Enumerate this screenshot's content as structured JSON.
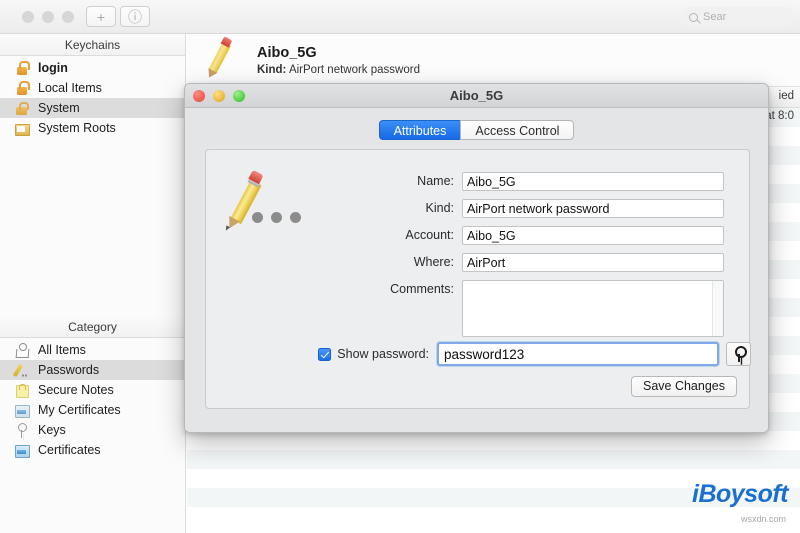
{
  "window": {
    "toolbar": {
      "add_label": "+",
      "info_label": "ⓘ",
      "search_placeholder": "Sear"
    }
  },
  "sidebar": {
    "keychains_header": "Keychains",
    "keychains": [
      {
        "label": "login",
        "icon": "lock-open-icon",
        "selected": false,
        "bold": true
      },
      {
        "label": "Local Items",
        "icon": "lock-open-icon",
        "selected": false,
        "bold": false
      },
      {
        "label": "System",
        "icon": "lock-closed-icon",
        "selected": true,
        "bold": false
      },
      {
        "label": "System Roots",
        "icon": "folder-icon",
        "selected": false,
        "bold": false
      }
    ],
    "category_header": "Category",
    "categories": [
      {
        "label": "All Items",
        "icon": "keyring-icon",
        "selected": false
      },
      {
        "label": "Passwords",
        "icon": "pencil-icon",
        "selected": true
      },
      {
        "label": "Secure Notes",
        "icon": "note-icon",
        "selected": false
      },
      {
        "label": "My Certificates",
        "icon": "certificate-icon",
        "selected": false
      },
      {
        "label": "Keys",
        "icon": "key-icon",
        "selected": false
      },
      {
        "label": "Certificates",
        "icon": "certificate-blue-icon",
        "selected": false
      }
    ]
  },
  "content": {
    "item_title": "Aibo_5G",
    "item_kind_label": "Kind:",
    "item_kind_value": "AirPort network password",
    "column_modified": "ied",
    "row_modified_value": "at 8:0",
    "watermark": "iBoysoft",
    "watermark_sub": "wsxdn.com"
  },
  "dialog": {
    "title": "Aibo_5G",
    "tabs": [
      {
        "label": "Attributes",
        "active": true
      },
      {
        "label": "Access Control",
        "active": false
      }
    ],
    "fields": [
      {
        "label": "Name:",
        "value": "Aibo_5G"
      },
      {
        "label": "Kind:",
        "value": "AirPort network password"
      },
      {
        "label": "Account:",
        "value": "Aibo_5G"
      },
      {
        "label": "Where:",
        "value": "AirPort"
      }
    ],
    "comments_label": "Comments:",
    "comments_value": "",
    "show_password_label": "Show password:",
    "show_password_checked": true,
    "password_value": "password123",
    "save_label": "Save Changes"
  },
  "colors": {
    "accent_blue": "#1769e8",
    "focus_ring": "#7fa9e8",
    "watermark_blue": "#1b6fd0",
    "lock_orange": "#e09226"
  }
}
